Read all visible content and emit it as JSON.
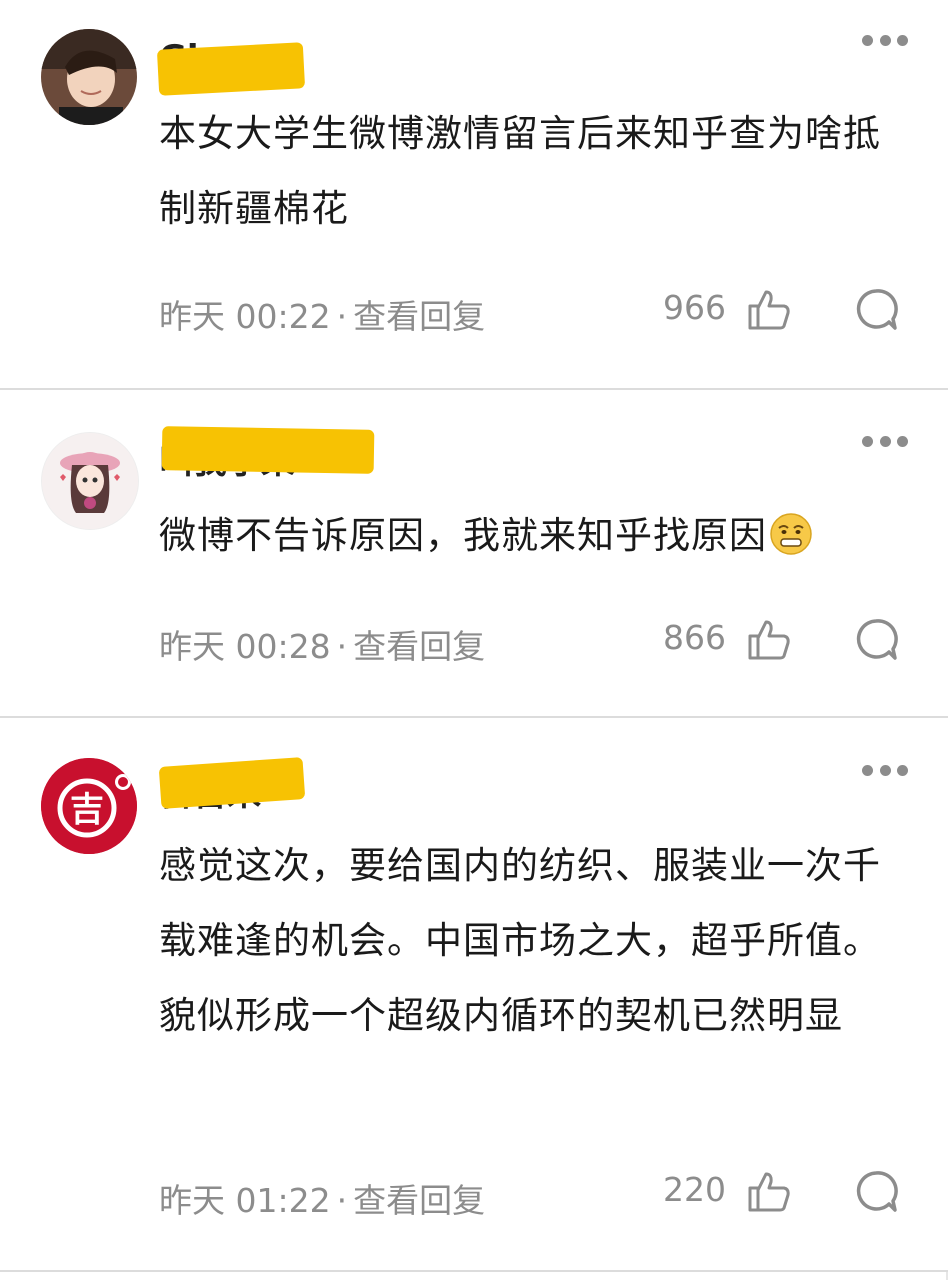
{
  "comments": [
    {
      "username": "Gi",
      "text": "本女大学生微博激情留言后来知乎查为啥抵制新疆棉花",
      "time": "昨天 00:22",
      "reply_link": "查看回复",
      "likes": "966"
    },
    {
      "username": "叫我小呆",
      "text": "微博不告诉原因，我就来知乎找原因",
      "emoji": "grimace-emoji",
      "time": "昨天 00:28",
      "reply_link": "查看回复",
      "likes": "866"
    },
    {
      "username": "吉吉米",
      "avatar_text": "吉",
      "text": "感觉这次，要给国内的纺织、服装业一次千载难逢的机会。中国市场之大，超乎所值。貌似形成一个超级内循环的契机已然明显",
      "time": "昨天 01:22",
      "reply_link": "查看回复",
      "likes": "220"
    }
  ],
  "separator": "·",
  "icons": {
    "more": "more-dots-icon",
    "like": "thumbs-up-icon",
    "reply": "comment-bubble-icon"
  },
  "colors": {
    "redaction": "#f7c203",
    "meta": "#8c8c8c",
    "avatar_red": "#c8102e"
  }
}
